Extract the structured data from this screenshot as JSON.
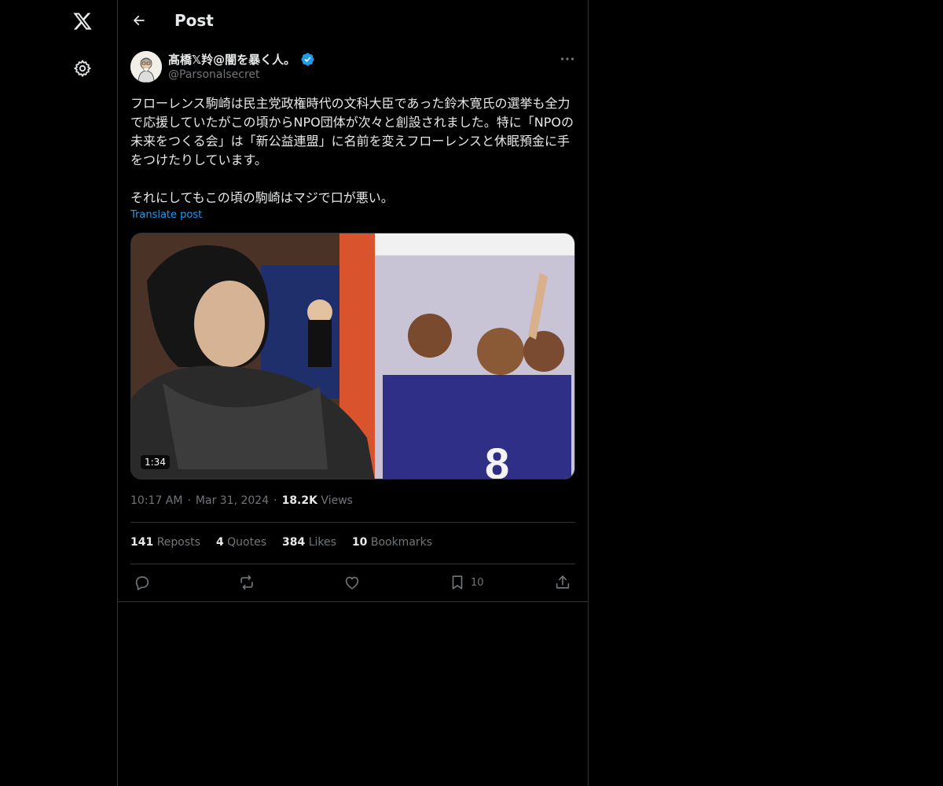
{
  "nav": {
    "logo_icon": "x-logo-icon",
    "settings_icon": "gear-icon"
  },
  "header": {
    "title": "Post",
    "back_icon": "arrow-left-icon"
  },
  "post": {
    "author_name": "髙橋𝕏羚@闇を暴く人。",
    "handle": "@Parsonalsecret",
    "verified": true,
    "text": "フローレンス駒崎は民主党政権時代の文科大臣であった鈴木寛氏の選挙も全力で応援していたがこの頃からNPO団体が次々と創設されました。特に「NPOの未来をつくる会」は「新公益連盟」に名前を変えフローレンスと休眠預金に手をつけたりしています。\n\nそれにしてもこの頃の駒崎はマジで口が悪い。",
    "translate_label": "Translate post",
    "video_duration": "1:34",
    "time": "10:17 AM",
    "date": "Mar 31, 2024",
    "views_count": "18.2K",
    "views_label": "Views"
  },
  "stats": {
    "reposts_count": "141",
    "reposts_label": "Reposts",
    "quotes_count": "4",
    "quotes_label": "Quotes",
    "likes_count": "384",
    "likes_label": "Likes",
    "bookmarks_count": "10",
    "bookmarks_label": "Bookmarks"
  },
  "actions": {
    "bookmark_count": "10"
  },
  "colors": {
    "background": "#000000",
    "text": "#e7e9ea",
    "muted": "#71767b",
    "accent": "#1d9bf0",
    "border": "#2f3336"
  }
}
